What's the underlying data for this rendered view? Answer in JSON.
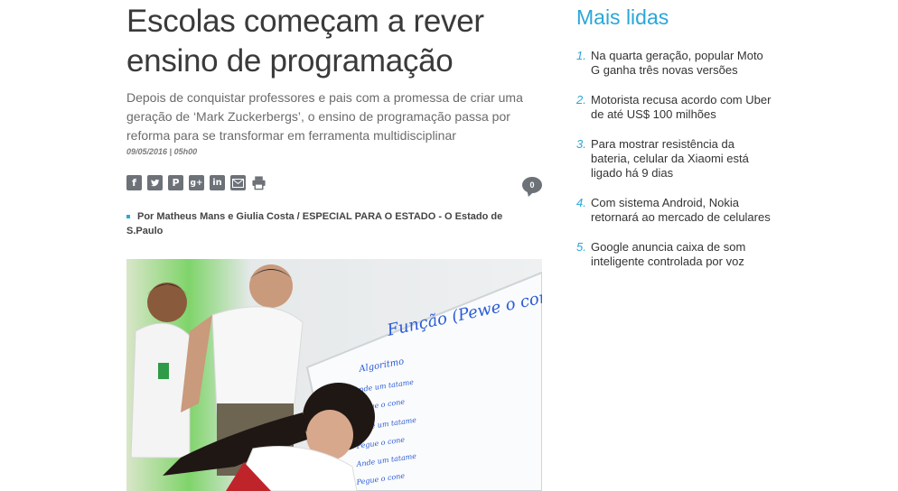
{
  "article": {
    "title": "Escolas começam a rever ensino de programação",
    "subtitle": "Depois de conquistar professores e pais com a promessa de criar uma geração de ‘Mark Zuckerbergs’, o ensino de programação passa por reforma para se transformar em ferramenta multidisciplinar",
    "date": "09/05/2016 | 05h00",
    "comment_count": "0",
    "byline": "Por Matheus Mans e Giulia Costa / ESPECIAL PARA O ESTADO - O Estado de S.Paulo",
    "share_icons": [
      "facebook-icon",
      "twitter-icon",
      "pinterest-icon",
      "googleplus-icon",
      "linkedin-icon",
      "email-icon",
      "print-icon"
    ],
    "whiteboard_text": [
      "Função (Pewe o cone",
      "Algoritmo",
      "Ande um tatame",
      "Pegue o cone",
      "Ande um tatame",
      "Pegue o cone",
      "Ande um tatame",
      "Pegue o cone"
    ]
  },
  "sidebar": {
    "title": "Mais lidas",
    "items": [
      {
        "num": "1.",
        "text": "Na quarta geração, popular Moto G ganha três novas versões"
      },
      {
        "num": "2.",
        "text": "Motorista recusa acordo com Uber de até US$ 100 milhões"
      },
      {
        "num": "3.",
        "text": "Para mostrar resistência da bateria, celular da Xiaomi está ligado há 9 dias"
      },
      {
        "num": "4.",
        "text": "Com sistema Android, Nokia retornará ao mercado de celulares"
      },
      {
        "num": "5.",
        "text": "Google anuncia caixa de som inteligente controlada por voz"
      }
    ]
  },
  "colors": {
    "accent": "#2aa7d8",
    "icon_gray": "#6d7178"
  }
}
